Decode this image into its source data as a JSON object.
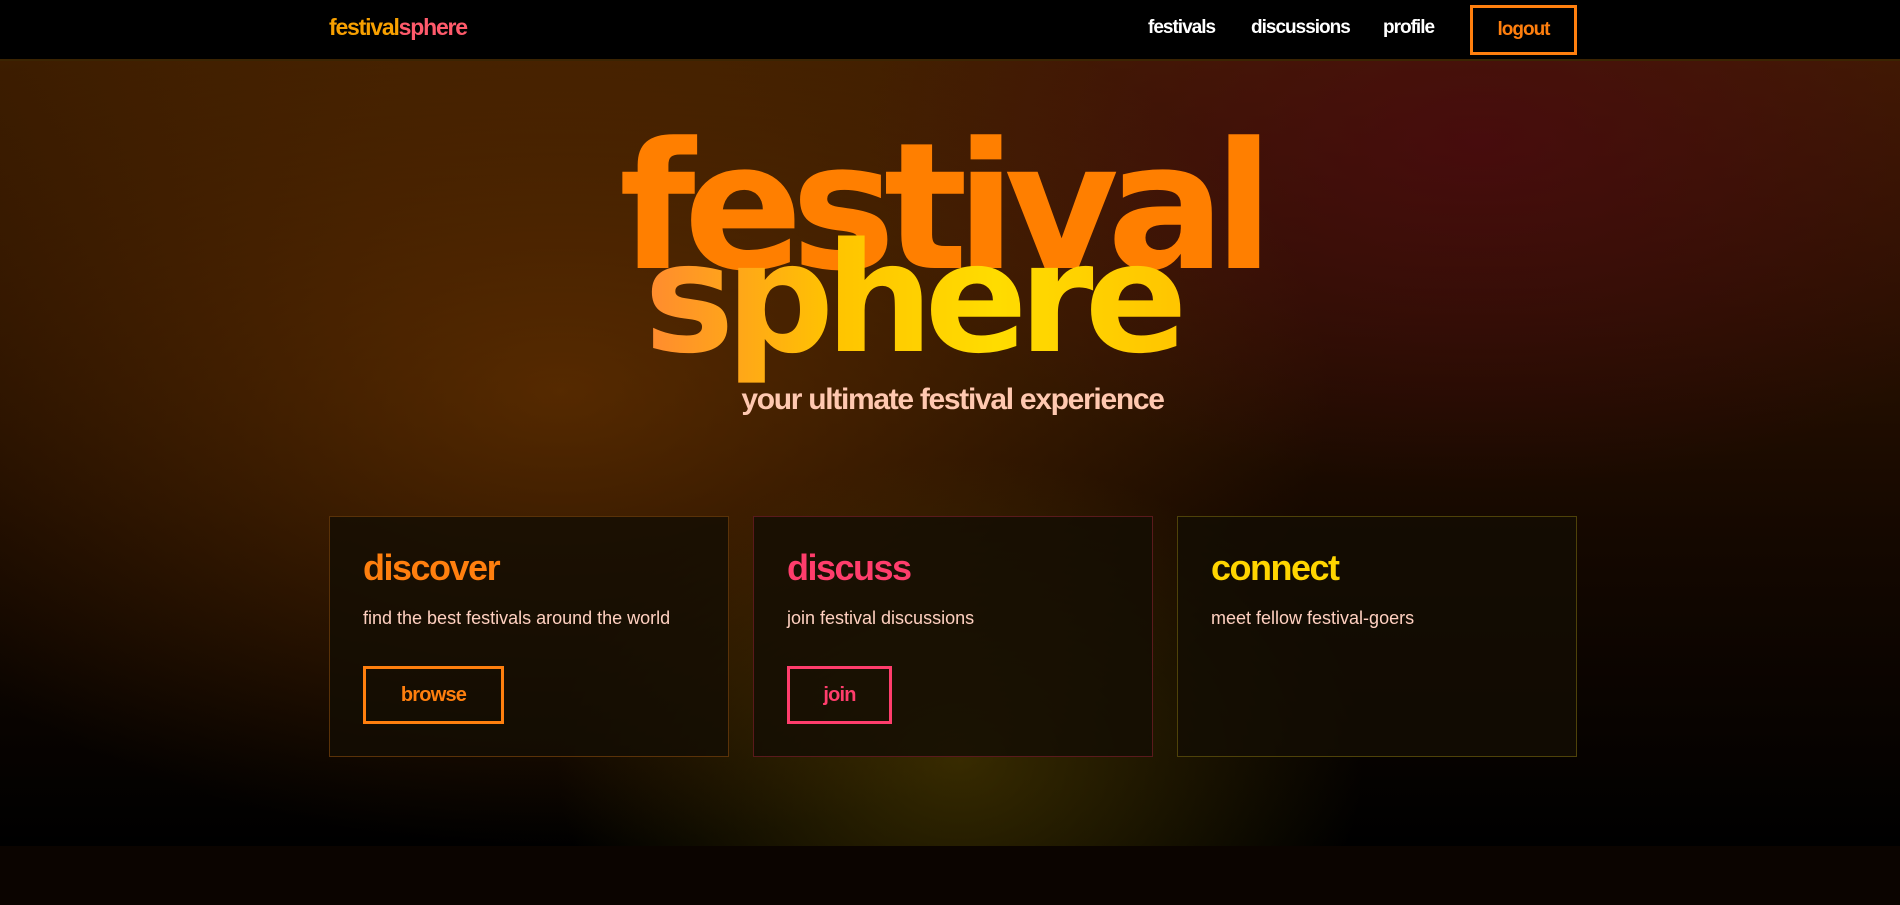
{
  "colors": {
    "orange": "#ff7f0e",
    "pink": "#ff3d6c",
    "yellow": "#ffd500",
    "text_light": "#ffd0c0"
  },
  "nav": {
    "brand_part1": "festival",
    "brand_part2": "sphere",
    "links": [
      "festivals",
      "discussions",
      "profile"
    ],
    "logout_label": "logout"
  },
  "hero": {
    "title_line1": "festival",
    "title_line2": "sphere",
    "tagline": "your ultimate festival experience"
  },
  "cards": [
    {
      "title": "discover",
      "text": "find the best festivals around the world",
      "button": "browse"
    },
    {
      "title": "discuss",
      "text": "join festival discussions",
      "button": "join"
    },
    {
      "title": "connect",
      "text": "meet fellow festival-goers"
    }
  ]
}
